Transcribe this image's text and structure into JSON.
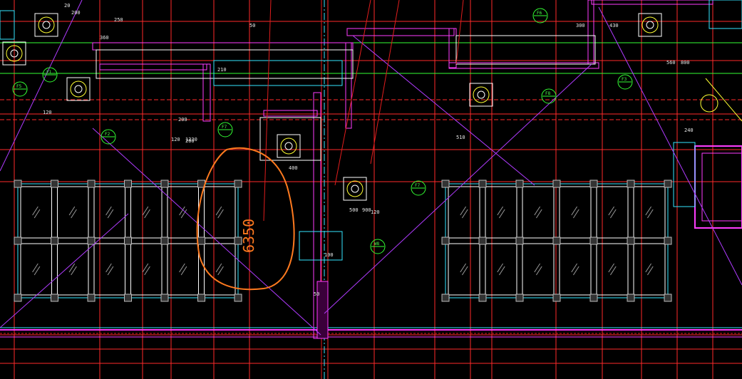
{
  "colors": {
    "background": "#000000",
    "grid_line": "#ff2a2a",
    "axis_line": "#e11d1d",
    "wall": "#ff3dff",
    "duct": "#ffffff",
    "cyan": "#33e6ff",
    "green": "#33ff33",
    "yellow": "#ffff33",
    "markup": "#ff7a1f",
    "diag": "#b03bff"
  },
  "annotations": {
    "handwritten_markup": "6350",
    "dims": [
      "200",
      "120",
      "250",
      "50",
      "20",
      "120",
      "300",
      "430",
      "210",
      "360",
      "200",
      "200",
      "1230",
      "510",
      "500",
      "900",
      "120",
      "100",
      "50",
      "560",
      "800",
      "240",
      "400"
    ],
    "tags": [
      "F5",
      "F1",
      "F2",
      "F7",
      "F8",
      "F3",
      "F6",
      "F7",
      "W8"
    ]
  }
}
